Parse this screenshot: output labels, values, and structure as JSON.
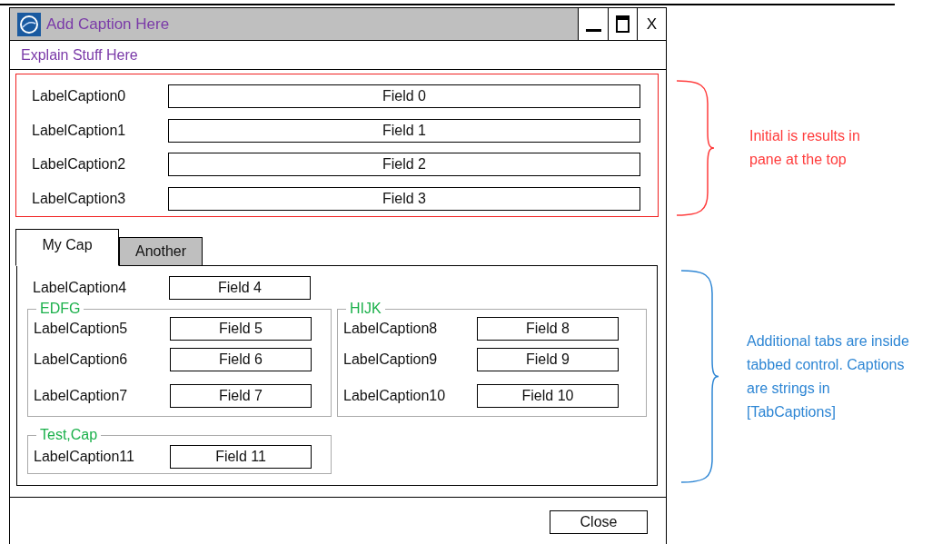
{
  "window": {
    "title": "Add Caption Here",
    "close_glyph": "X"
  },
  "subtitle": "Explain Stuff Here",
  "top_pane": {
    "fields": [
      {
        "label": "LabelCaption0",
        "value": "Field 0"
      },
      {
        "label": "LabelCaption1",
        "value": "Field 1"
      },
      {
        "label": "LabelCaption2",
        "value": "Field 2"
      },
      {
        "label": "LabelCaption3",
        "value": "Field 3"
      }
    ]
  },
  "tabs": [
    {
      "label": "My Cap",
      "selected": true
    },
    {
      "label": "Another",
      "selected": false
    }
  ],
  "tab_content": {
    "fields": [
      {
        "label": "LabelCaption4",
        "value": "Field 4"
      }
    ],
    "groups": [
      {
        "title": "EDFG",
        "fields": [
          {
            "label": "LabelCaption5",
            "value": "Field 5"
          },
          {
            "label": "LabelCaption6",
            "value": "Field 6"
          },
          {
            "label": "LabelCaption7",
            "value": "Field 7"
          }
        ]
      },
      {
        "title": "HIJK",
        "fields": [
          {
            "label": "LabelCaption8",
            "value": "Field 8"
          },
          {
            "label": "LabelCaption9",
            "value": "Field 9"
          },
          {
            "label": "LabelCaption10",
            "value": "Field 10"
          }
        ]
      },
      {
        "title": "Test,Cap",
        "fields": [
          {
            "label": "LabelCaption11",
            "value": "Field 11"
          }
        ]
      }
    ]
  },
  "footer": {
    "buttons": [
      "Close"
    ]
  },
  "annotations": [
    {
      "text": "Initial is results in pane at the top",
      "color": "#ff3b3b"
    },
    {
      "text": "Additional tabs are inside tabbed control. Captions are strings in [TabCaptions]",
      "color": "#2e86d4"
    }
  ]
}
